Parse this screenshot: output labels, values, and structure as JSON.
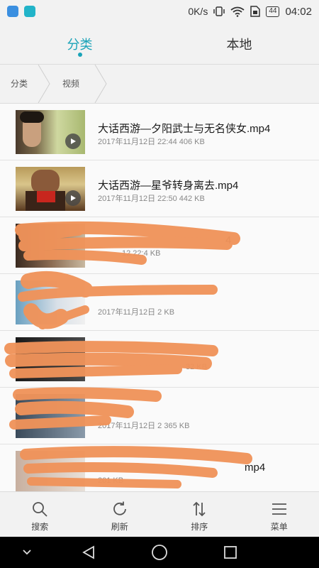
{
  "statusbar": {
    "left_icons": [
      "gallery-app-icon",
      "message-app-icon"
    ],
    "network_speed": "0K/s",
    "battery_level": "44",
    "time": "04:02"
  },
  "tabs": [
    {
      "label": "分类",
      "active": true
    },
    {
      "label": "本地",
      "active": false
    }
  ],
  "breadcrumb": [
    "分类",
    "视频"
  ],
  "files": [
    {
      "name": "大话西游—夕阳武士与无名侠女.mp4",
      "meta": "2017年11月12日 22:44 406 KB"
    },
    {
      "name": "大话西游—星爷转身离去.mp4",
      "meta": "2017年11月12日 22:50 442 KB"
    },
    {
      "name": "4",
      "meta": "12  22:4  KB"
    },
    {
      "name": "",
      "meta": "2017年11月12日 2   KB"
    },
    {
      "name": "",
      "meta": "32 KB"
    },
    {
      "name": "",
      "meta": "2017年11月12日 2  365 KB"
    },
    {
      "name": "mp4",
      "meta": "201  KB"
    }
  ],
  "bottom_actions": [
    {
      "label": "搜索",
      "icon": "search-icon"
    },
    {
      "label": "刷新",
      "icon": "refresh-icon"
    },
    {
      "label": "排序",
      "icon": "sort-icon"
    },
    {
      "label": "菜单",
      "icon": "menu-icon"
    }
  ],
  "navbar_icons": [
    "collapse-icon",
    "back-icon",
    "home-icon",
    "recents-icon"
  ],
  "colors": {
    "accent": "#1aa3b8",
    "redaction": "#f0935a"
  }
}
